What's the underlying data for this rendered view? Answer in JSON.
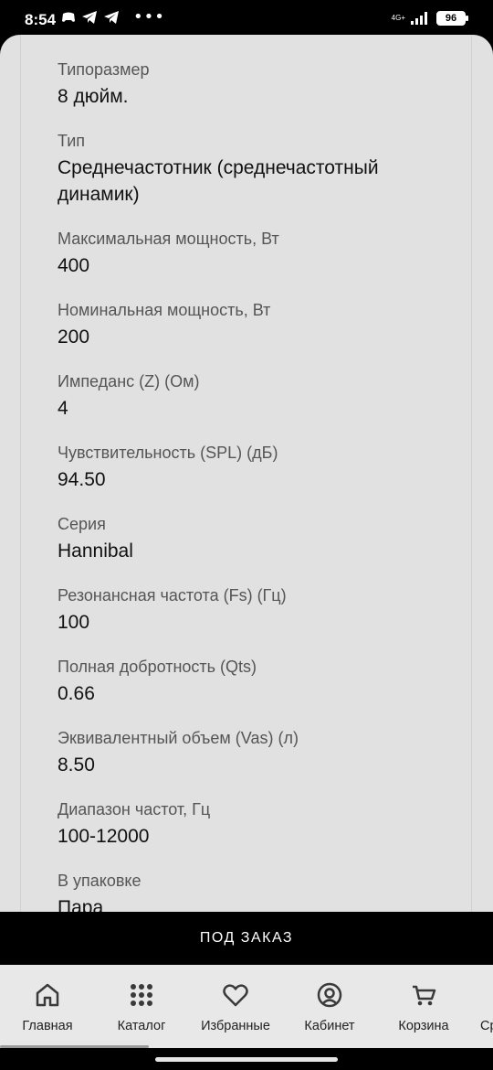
{
  "status_bar": {
    "time": "8:54",
    "network": "4G+",
    "battery": "96"
  },
  "specs": [
    {
      "label": "Типоразмер",
      "value": "8 дюйм."
    },
    {
      "label": "Тип",
      "value": "Среднечастотник (среднечастотный динамик)"
    },
    {
      "label": "Максимальная мощность, Вт",
      "value": "400"
    },
    {
      "label": "Номинальная мощность, Вт",
      "value": "200"
    },
    {
      "label": "Импеданс (Z) (Ом)",
      "value": "4"
    },
    {
      "label": "Чувствительность (SPL) (дБ)",
      "value": "94.50"
    },
    {
      "label": "Серия",
      "value": "Hannibal"
    },
    {
      "label": "Резонансная частота (Fs) (Гц)",
      "value": "100"
    },
    {
      "label": "Полная добротность (Qts)",
      "value": "0.66"
    },
    {
      "label": "Эквивалентный объем (Vas) (л)",
      "value": "8.50"
    },
    {
      "label": "Диапазон частот, Гц",
      "value": "100-12000"
    },
    {
      "label": "В упаковке",
      "value": "Пара"
    }
  ],
  "order_button": {
    "label": "ПОД ЗАКАЗ"
  },
  "bottom_nav": [
    {
      "label": "Главная",
      "icon": "home-icon"
    },
    {
      "label": "Каталог",
      "icon": "grid-icon"
    },
    {
      "label": "Избранные",
      "icon": "heart-icon"
    },
    {
      "label": "Кабинет",
      "icon": "user-icon"
    },
    {
      "label": "Корзина",
      "icon": "cart-icon"
    },
    {
      "label": "Ср",
      "icon": "compare-icon"
    }
  ]
}
